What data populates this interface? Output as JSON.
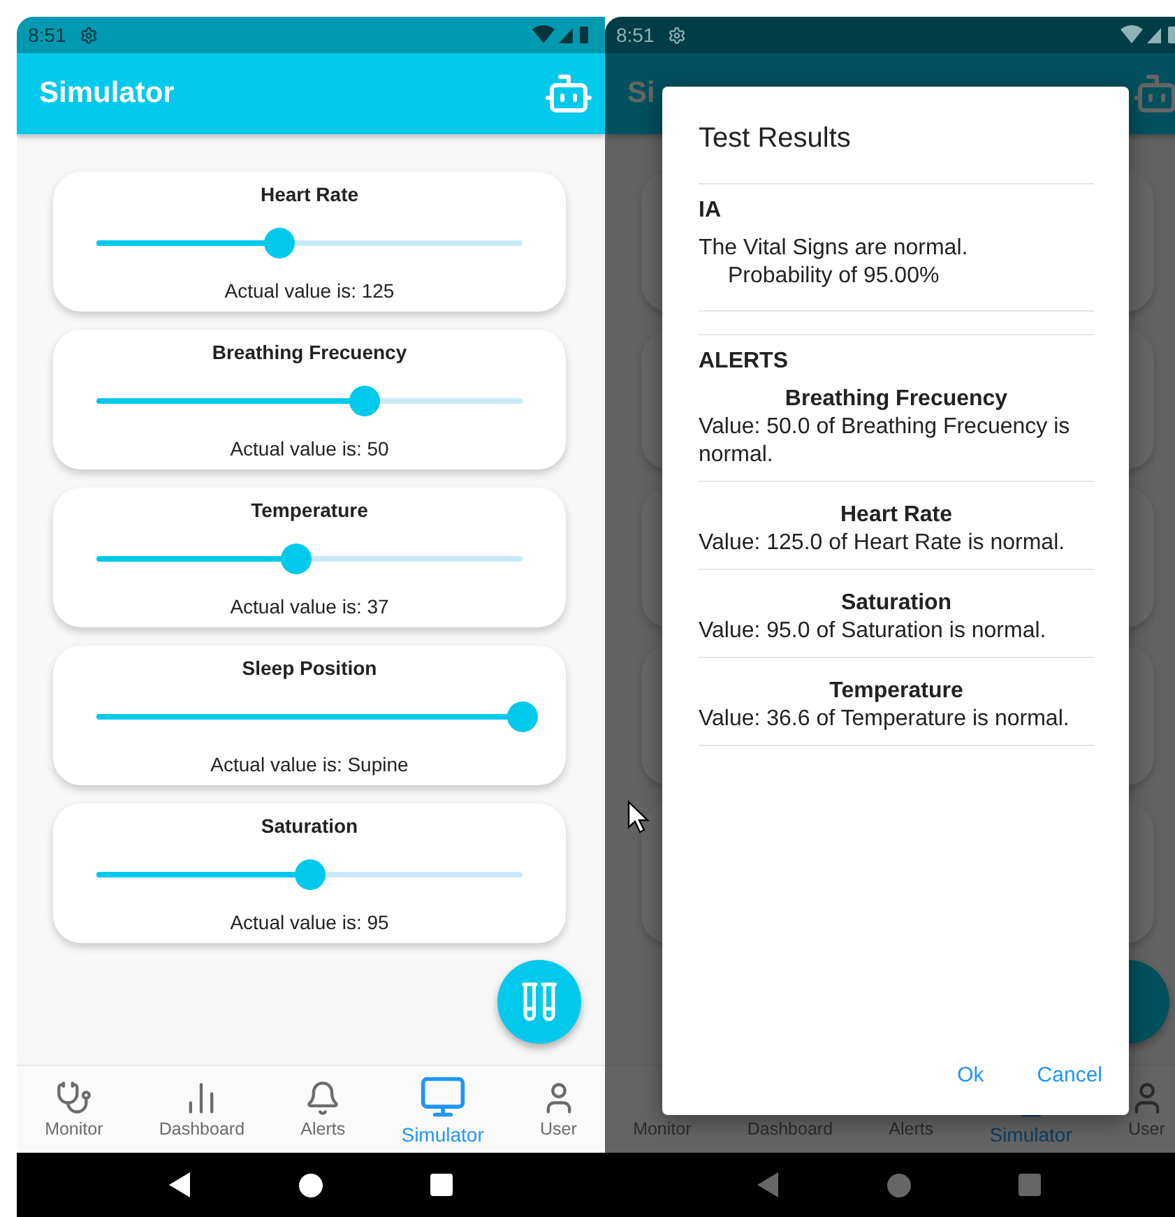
{
  "screens": [
    {
      "status_bar": {
        "time": "8:51"
      },
      "app_bar": {
        "title": "Simulator"
      },
      "sliders": [
        {
          "label": "Heart Rate",
          "level": 0.43,
          "reading": "Actual value is: 125"
        },
        {
          "label": "Breathing Frecuency",
          "level": 0.63,
          "reading": "Actual value is: 50"
        },
        {
          "label": "Temperature",
          "level": 0.47,
          "reading": "Actual value is: 37"
        },
        {
          "label": "Sleep Position",
          "level": 1.0,
          "reading": "Actual value is: Supine"
        },
        {
          "label": "Saturation",
          "level": 0.5,
          "reading": "Actual value is: 95"
        }
      ],
      "nav": [
        {
          "kind": "monitor",
          "label": "Monitor",
          "selected": false
        },
        {
          "kind": "dashboard",
          "label": "Dashboard",
          "selected": false
        },
        {
          "kind": "alerts",
          "label": "Alerts",
          "selected": false
        },
        {
          "kind": "simulator",
          "label": "Simulator",
          "selected": true
        },
        {
          "kind": "user",
          "label": "User",
          "selected": false
        }
      ]
    },
    {
      "status_bar": {
        "time": "8:51"
      },
      "app_bar": {
        "title": "Si"
      },
      "nav": [
        {
          "label": "Monitor",
          "selected": false
        },
        {
          "label": "Dashboard",
          "selected": false
        },
        {
          "label": "Alerts",
          "selected": false
        },
        {
          "kind": "simulator",
          "label": "Simulator",
          "selected": true
        },
        {
          "kind": "user",
          "label": "User",
          "selected": false
        }
      ],
      "dialog": {
        "title": "Test Results",
        "ia": {
          "heading": "IA",
          "lines": [
            "The Vital Signs are normal.",
            "Probability of 95.00%"
          ]
        },
        "alerts_heading": "ALERTS",
        "alerts": [
          {
            "name": "Breathing Frecuency",
            "text": "Value: 50.0 of Breathing Frecuency is normal."
          },
          {
            "name": "Heart Rate",
            "text": "Value: 125.0 of Heart Rate is normal."
          },
          {
            "name": "Saturation",
            "text": "Value: 95.0 of Saturation is normal."
          },
          {
            "name": "Temperature",
            "text": "Value: 36.6 of Temperature is normal."
          }
        ],
        "buttons": [
          "Ok",
          "Cancel"
        ]
      }
    }
  ]
}
